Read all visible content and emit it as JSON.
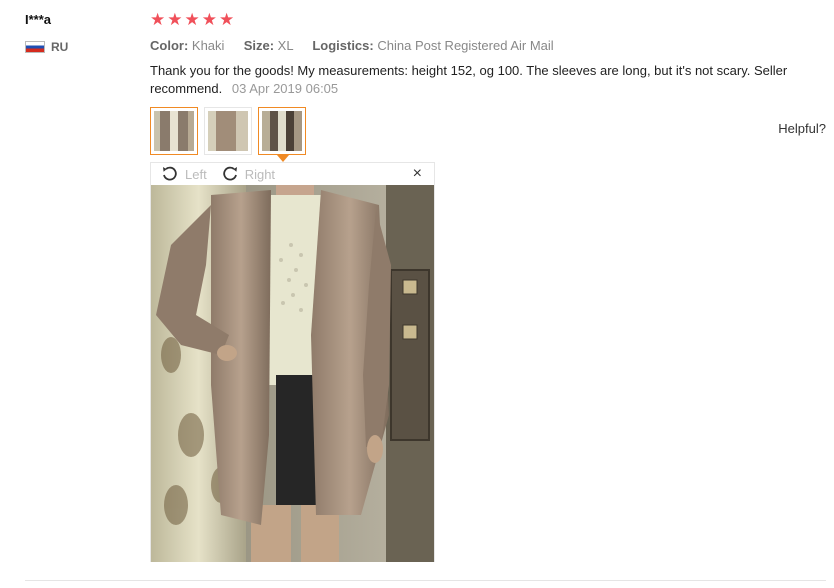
{
  "review": {
    "user_name": "I***a",
    "country_code": "RU",
    "rating": 5,
    "stars": [
      "★",
      "★",
      "★",
      "★",
      "★"
    ],
    "star_color": "#f0505a",
    "attributes": [
      {
        "key": "Color:",
        "value": "Khaki"
      },
      {
        "key": "Size:",
        "value": "XL"
      },
      {
        "key": "Logistics:",
        "value": "China Post Registered Air Mail"
      }
    ],
    "text": "Thank you for the goods! My measurements: height 152, og 100. The sleeves are long, but it's not scary. Seller recommend.",
    "date": "03 Apr 2019 06:05",
    "helpful_label": "Helpful?"
  },
  "viewer": {
    "rotate_left_label": "Left",
    "rotate_right_label": "Right",
    "close_glyph": "×"
  },
  "thumbnails": [
    {
      "name": "review-photo-thumb-1",
      "selected": false
    },
    {
      "name": "review-photo-thumb-2",
      "selected": false
    },
    {
      "name": "review-photo-thumb-3",
      "selected": true
    }
  ],
  "colors": {
    "accent_orange": "#f08a24"
  }
}
